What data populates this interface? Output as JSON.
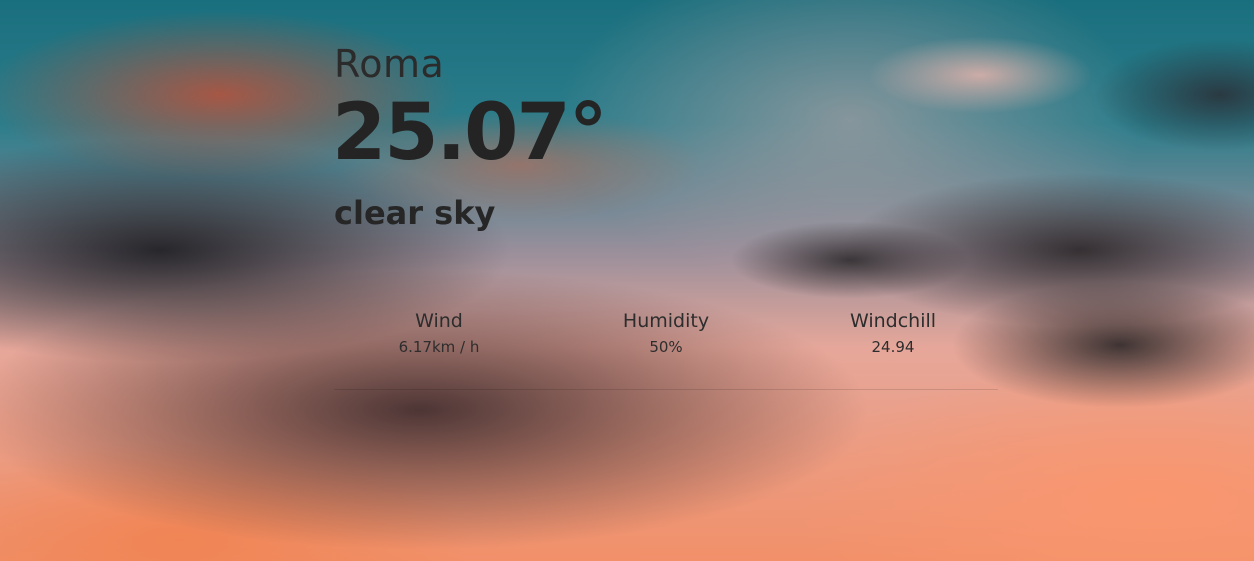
{
  "weather": {
    "city": "Roma",
    "temperature": "25.07°",
    "description": "clear sky",
    "stats": [
      {
        "label": "Wind",
        "value": "6.17km / h"
      },
      {
        "label": "Humidity",
        "value": "50%"
      },
      {
        "label": "Windchill",
        "value": "24.94"
      }
    ]
  }
}
